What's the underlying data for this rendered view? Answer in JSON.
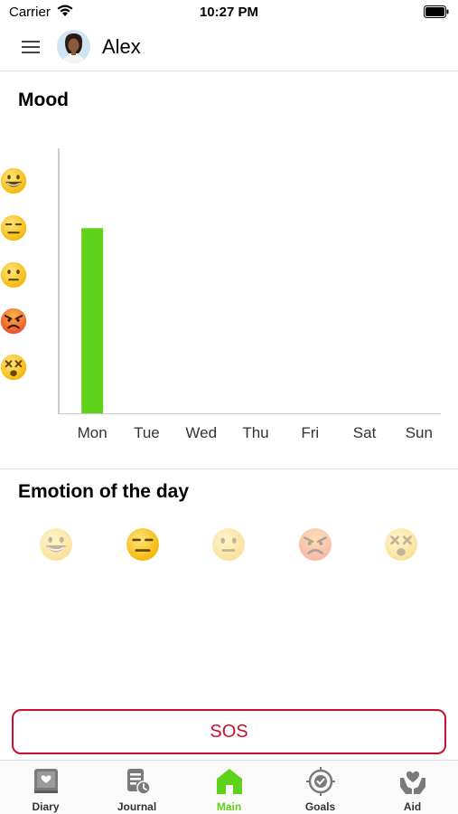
{
  "status_bar": {
    "carrier": "Carrier",
    "time": "10:27 PM"
  },
  "header": {
    "user_name": "Alex"
  },
  "mood": {
    "title": "Mood",
    "y_levels": [
      "grinning-emoji-icon",
      "expressionless-emoji-icon",
      "neutral-emoji-icon",
      "angry-emoji-icon",
      "dizzy-emoji-icon"
    ]
  },
  "chart_data": {
    "type": "bar",
    "categories": [
      "Mon",
      "Tue",
      "Wed",
      "Thu",
      "Fri",
      "Sat",
      "Sun"
    ],
    "values": [
      4,
      null,
      null,
      null,
      null,
      null,
      null
    ],
    "ylim": [
      0,
      5
    ],
    "y_tick_labels": [
      "dizzy",
      "angry",
      "neutral",
      "expressionless",
      "grinning"
    ],
    "bar_color": "#5fd21b",
    "grid": false
  },
  "emotion": {
    "title": "Emotion of the day",
    "options": [
      "grinning",
      "expressionless",
      "neutral",
      "angry",
      "dizzy"
    ],
    "selected": "expressionless"
  },
  "sos": {
    "label": "SOS",
    "color": "#c8102e"
  },
  "tabs": [
    {
      "label": "Diary",
      "icon": "diary-icon"
    },
    {
      "label": "Journal",
      "icon": "journal-icon"
    },
    {
      "label": "Main",
      "icon": "home-icon",
      "active": true
    },
    {
      "label": "Goals",
      "icon": "goals-icon"
    },
    {
      "label": "Aid",
      "icon": "aid-icon"
    }
  ],
  "colors": {
    "accent": "#5fd21b",
    "danger": "#c8102e"
  }
}
